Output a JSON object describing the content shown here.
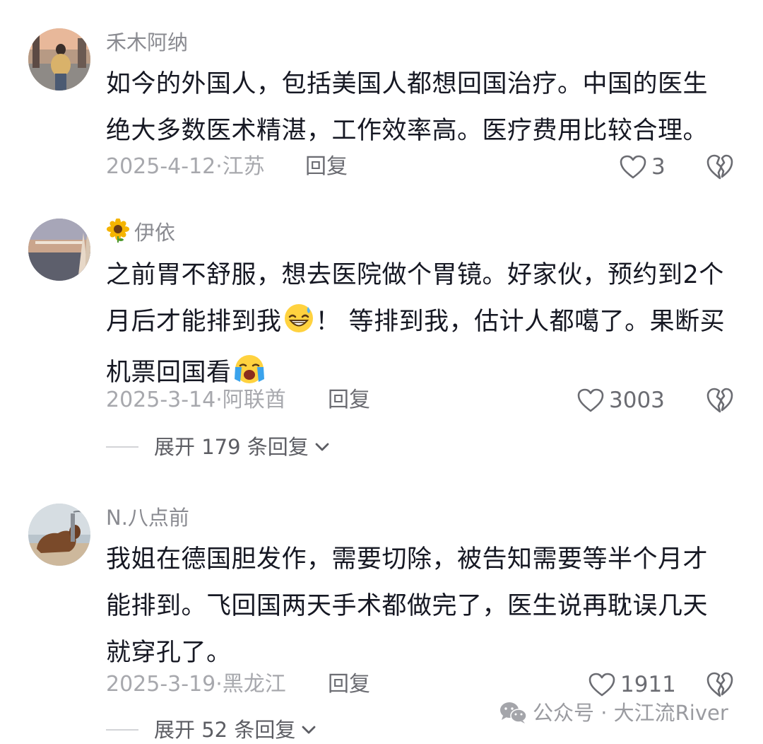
{
  "comments": [
    {
      "username": "禾木阿纳",
      "text_lines": [
        "如今的外国人，包括美国人都想回国治疗。中国的医生",
        "绝大多数医术精湛，工作效率高。医疗费用比较合理。"
      ],
      "date_location": "2025-4-12·江苏",
      "reply_label": "回复",
      "likes": "3"
    },
    {
      "username": "伊依",
      "username_icon": "sunflower-icon",
      "line1": "之前胃不舒服，想去医院做个胃镜。好家伙，预约到2个",
      "line2_a": "月后才能排到我",
      "line2_emoji": "grinning-sweat-emoji",
      "line2_b": "！ 等排到我，估计人都噶了。果断买",
      "line3_a": "机票回国看",
      "line3_emoji": "loudly-crying-emoji",
      "date_location": "2025-3-14·阿联酋",
      "reply_label": "回复",
      "likes": "3003",
      "expand_label": "展开 179 条回复"
    },
    {
      "username": "N.八点前",
      "text_lines": [
        "我姐在德国胆发作，需要切除，被告知需要等半个月才",
        "能排到。飞回国两天手术都做完了，医生说再耽误几天",
        "就穿孔了。"
      ],
      "date_location": "2025-3-19·黑龙江",
      "reply_label": "回复",
      "likes": "1911",
      "expand_label": "展开 52 条回复"
    }
  ],
  "watermark": {
    "icon": "wechat-icon",
    "text": "公众号 · 大江流River"
  },
  "colors": {
    "text_primary": "#161823",
    "text_secondary": "#8a8b91",
    "meta": "#a7a8ad"
  }
}
